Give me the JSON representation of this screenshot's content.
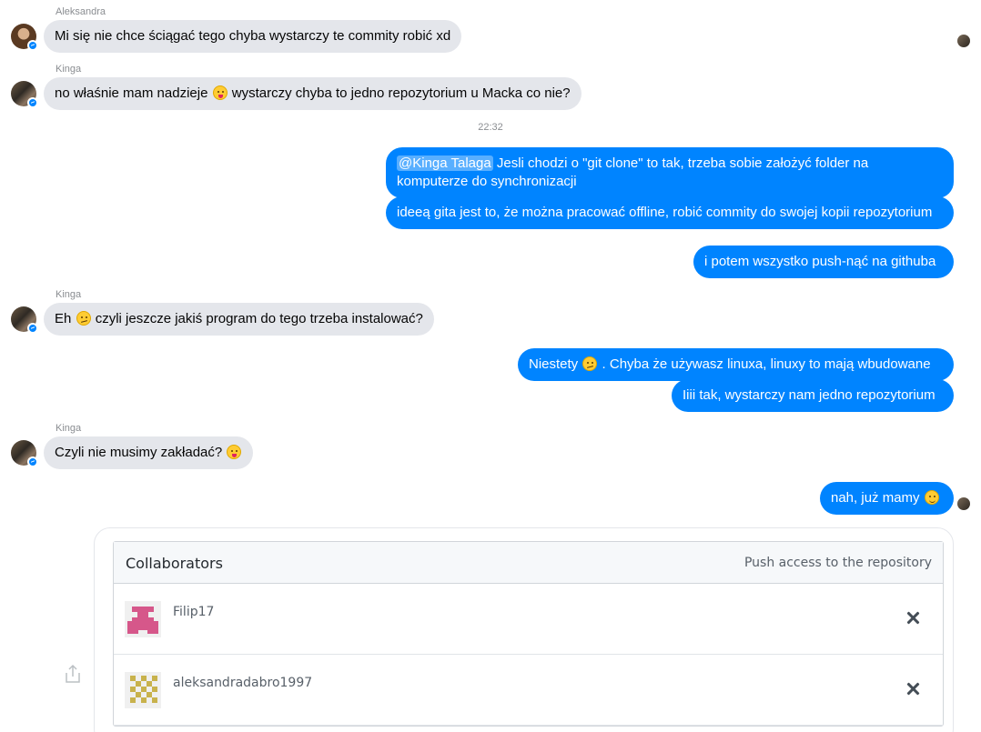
{
  "messages": [
    {
      "sender": "Aleksandra",
      "text": "Mi się nie chce ściągać tego chyba wystarczy te commity robić xd"
    },
    {
      "sender": "Kinga",
      "text_before": "no właśnie mam nadzieje",
      "emoji": "tongue-face-emoji",
      "text_after": "wystarczy chyba to jedno repozytorium u Macka co nie?"
    },
    {
      "timestamp": "22:32"
    },
    {
      "mention": "@Kinga Talaga",
      "text": " Jesli chodzi o \"git clone\" to tak, trzeba sobie założyć folder na komputerze do synchronizacji"
    },
    {
      "text": "ideeą gita jest to, że można pracować offline, robić commity do swojej kopii repozytorium"
    },
    {
      "text": "i potem wszystko push-nąć na githuba"
    },
    {
      "sender": "Kinga",
      "text_before": "Eh",
      "emoji": "confused-face-emoji",
      "text_after": "czyli jeszcze jakiś program do tego trzeba instalować?"
    },
    {
      "text_before": "Niestety",
      "emoji": "confused-face-emoji",
      "text_after": ". Chyba że używasz linuxa, linuxy to mają wbudowane"
    },
    {
      "text": "Iiii tak, wystarczy nam jedno repozytorium"
    },
    {
      "sender": "Kinga",
      "text_before": "Czyli nie musimy zakładać?",
      "emoji": "tongue-face-emoji"
    },
    {
      "text_before": "nah, już mamy",
      "emoji": "wink-face-emoji"
    }
  ],
  "attachment": {
    "title": "Collaborators",
    "subtitle": "Push access to the repository",
    "collaborators": [
      {
        "username": "Filip17",
        "identicon_color": "#d6578a"
      },
      {
        "username": "aleksandradabro1997",
        "identicon_color": "#c8b24c"
      }
    ]
  },
  "icons": {
    "share": "share-icon",
    "remove": "close-icon",
    "messenger_badge": "messenger-badge-icon"
  },
  "colors": {
    "outgoing_bubble": "#0084ff",
    "incoming_bubble": "#e4e6eb"
  }
}
